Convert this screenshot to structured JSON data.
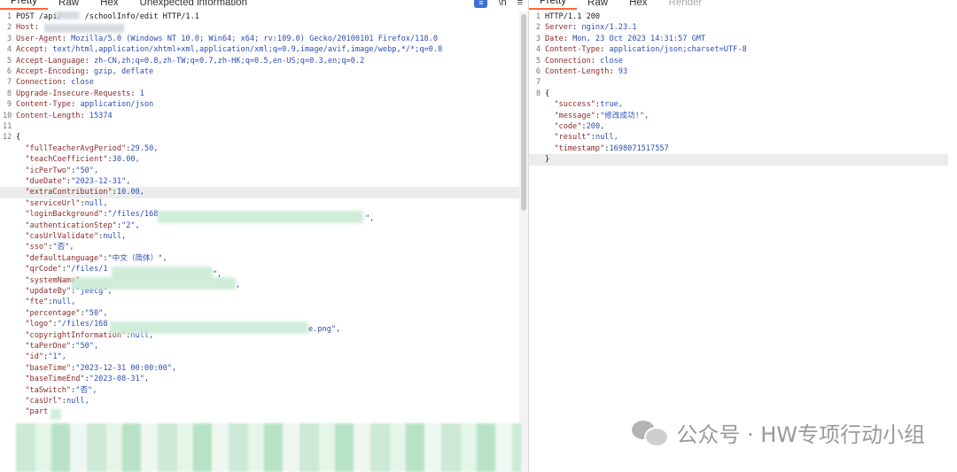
{
  "request": {
    "tabs": [
      "Pretty",
      "Raw",
      "Hex",
      "Unexpected information"
    ],
    "tools": {
      "badge": "≡",
      "wrap": "\\n",
      "menu": "≡"
    },
    "lines": [
      {
        "n": "1",
        "text": "POST /api/     /schoolInfo/edit HTTP/1.1"
      },
      {
        "n": "2",
        "key": "Host",
        "sep": ": ",
        "val": ""
      },
      {
        "n": "3",
        "key": "User-Agent",
        "sep": ": ",
        "val": "Mozilla/5.0 (Windows NT 10.0; Win64; x64; rv:109.0) Gecko/20100101 Firefox/118.0"
      },
      {
        "n": "4",
        "key": "Accept",
        "sep": ": ",
        "val": "text/html,application/xhtml+xml,application/xml;q=0.9,image/avif,image/webp,*/*;q=0.8"
      },
      {
        "n": "5",
        "key": "Accept-Language",
        "sep": ": ",
        "val": "zh-CN,zh;q=0.8,zh-TW;q=0.7,zh-HK;q=0.5,en-US;q=0.3,en;q=0.2"
      },
      {
        "n": "6",
        "key": "Accept-Encoding",
        "sep": ": ",
        "val": "gzip, deflate"
      },
      {
        "n": "7",
        "key": "Connection",
        "sep": ": ",
        "val": "close"
      },
      {
        "n": "8",
        "key": "Upgrade-Insecure-Requests",
        "sep": ": ",
        "val": "1"
      },
      {
        "n": "9",
        "key": "Content-Type",
        "sep": ": ",
        "val": "application/json"
      },
      {
        "n": "10",
        "key": "Content-Length",
        "sep": ": ",
        "val": "15374"
      },
      {
        "n": "11",
        "text": ""
      },
      {
        "n": "12",
        "text": "{"
      },
      {
        "n": "",
        "key": "  \"fullTeacherAvgPeriod\"",
        "sep": ":",
        "val": "29.50,"
      },
      {
        "n": "",
        "key": "  \"teachCoefficient\"",
        "sep": ":",
        "val": "30.00,"
      },
      {
        "n": "",
        "key": "  \"icPerTwo\"",
        "sep": ":",
        "val": "\"50\","
      },
      {
        "n": "",
        "key": "  \"dueDate\"",
        "sep": ":",
        "val": "\"2023-12-31\","
      },
      {
        "n": "",
        "key": "  \"extraContribution\"",
        "sep": ":",
        "val": "10.00,"
      },
      {
        "n": "",
        "key": "  \"serviceUrl\"",
        "sep": ":",
        "val": "null,"
      },
      {
        "n": "",
        "key": "  \"loginBackground\"",
        "sep": ":",
        "val": "\"/files/168"
      },
      {
        "n": "",
        "key": "  \"authenticationStep\"",
        "sep": ":",
        "val": "\"2\","
      },
      {
        "n": "",
        "key": "  \"casUrlValidate\"",
        "sep": ":",
        "val": "null,"
      },
      {
        "n": "",
        "key": "  \"sso\"",
        "sep": ":",
        "val": "\"否\","
      },
      {
        "n": "",
        "key": "  \"defaultLanguage\"",
        "sep": ":",
        "val": "\"中文（简体）\","
      },
      {
        "n": "",
        "key": "  \"qrCode\"",
        "sep": ":",
        "val": "\"/files/1"
      },
      {
        "n": "",
        "key": "  \"systemName\"",
        "sep": "",
        "val": ""
      },
      {
        "n": "",
        "key": "  \"updateBy\"",
        "sep": ":",
        "val": "\"jeecg\","
      },
      {
        "n": "",
        "key": "  \"fte\"",
        "sep": ":",
        "val": "null,"
      },
      {
        "n": "",
        "key": "  \"percentage\"",
        "sep": ":",
        "val": "\"50\","
      },
      {
        "n": "",
        "key": "  \"logo\"",
        "sep": ":",
        "val": "\"/files/168"
      },
      {
        "n": "",
        "key": "  \"copyrightInformation\"",
        "sep": ":",
        "val": "null,"
      },
      {
        "n": "",
        "key": "  \"taPerOne\"",
        "sep": ":",
        "val": "\"50\","
      },
      {
        "n": "",
        "key": "  \"id\"",
        "sep": ":",
        "val": "\"1\","
      },
      {
        "n": "",
        "key": "  \"baseTime\"",
        "sep": ":",
        "val": "\"2023-12-31 00:00:00\","
      },
      {
        "n": "",
        "key": "  \"baseTimeEnd\"",
        "sep": ":",
        "val": "\"2023-08-31\","
      },
      {
        "n": "",
        "key": "  \"taSwitch\"",
        "sep": ":",
        "val": "\"否\","
      },
      {
        "n": "",
        "key": "  \"casUrl\"",
        "sep": ":",
        "val": "null,"
      },
      {
        "n": "",
        "key": "  \"part",
        "sep": "",
        "val": ""
      }
    ],
    "tails": {
      "loginBackground": "\",",
      "qrCode": "\",",
      "systemName": ",",
      "logo": "e.png\","
    }
  },
  "response": {
    "tabs": [
      "Pretty",
      "Raw",
      "Hex",
      "Render"
    ],
    "lines": [
      {
        "n": "1",
        "text": "HTTP/1.1 200"
      },
      {
        "n": "2",
        "key": "Server",
        "sep": ": ",
        "val": "nginx/1.23.1"
      },
      {
        "n": "3",
        "key": "Date",
        "sep": ": ",
        "val": "Mon, 23 Oct 2023 14:31:57 GMT"
      },
      {
        "n": "4",
        "key": "Content-Type",
        "sep": ": ",
        "val": "application/json;charset=UTF-8"
      },
      {
        "n": "5",
        "key": "Connection",
        "sep": ": ",
        "val": "close"
      },
      {
        "n": "6",
        "key": "Content-Length",
        "sep": ": ",
        "val": "93"
      },
      {
        "n": "7",
        "text": ""
      },
      {
        "n": "8",
        "text": "{"
      },
      {
        "n": "",
        "key": "  \"success\"",
        "sep": ":",
        "val": "true,"
      },
      {
        "n": "",
        "key": "  \"message\"",
        "sep": ":",
        "val": "\"修改成功!\","
      },
      {
        "n": "",
        "key": "  \"code\"",
        "sep": ":",
        "val": "200,"
      },
      {
        "n": "",
        "key": "  \"result\"",
        "sep": ":",
        "val": "null,"
      },
      {
        "n": "",
        "key": "  \"timestamp\"",
        "sep": ":",
        "val": "1698071517557"
      },
      {
        "n": "",
        "text": "}"
      }
    ]
  },
  "watermark": {
    "text": "公众号 · HW专项行动小组"
  },
  "colors": {
    "key": "#8a2a2a",
    "value": "#2b4db6",
    "tab_active": "#ff6633"
  }
}
